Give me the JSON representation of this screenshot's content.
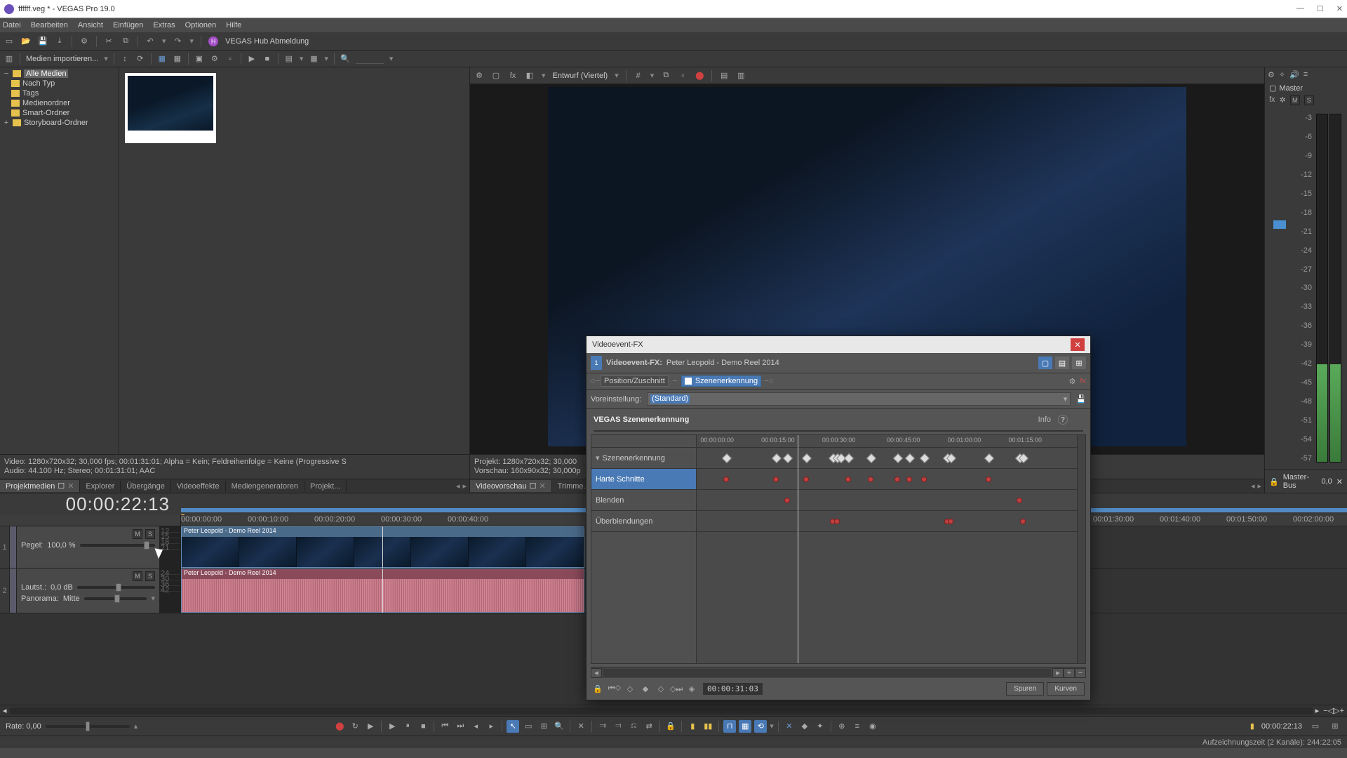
{
  "window": {
    "title": "ffffff.veg * - VEGAS Pro 19.0"
  },
  "menu": [
    "Datei",
    "Bearbeiten",
    "Ansicht",
    "Einfügen",
    "Extras",
    "Optionen",
    "Hilfe"
  ],
  "hub": {
    "label": "VEGAS Hub Abmeldung",
    "badge": "H"
  },
  "import_btn": "Medien importieren...",
  "media_tree": {
    "items": [
      {
        "label": "Alle Medien",
        "selected": true
      },
      {
        "label": "Nach Typ"
      },
      {
        "label": "Tags"
      },
      {
        "label": "Medienordner"
      },
      {
        "label": "Smart-Ordner"
      },
      {
        "label": "Storyboard-Ordner",
        "expandable": true
      }
    ]
  },
  "left_info": {
    "line1": "Video: 1280x720x32; 30,000 fps; 00:01:31:01; Alpha = Kein; Feldreihenfolge = Keine (Progressive S",
    "line2": "Audio: 44.100 Hz; Stereo; 00:01:31:01; AAC"
  },
  "dock_left": {
    "tabs": [
      "Projektmedien",
      "Explorer",
      "Übergänge",
      "Videoeffekte",
      "Mediengeneratoren",
      "Projekt..."
    ],
    "active": 0
  },
  "preview": {
    "quality": "Entwurf (Viertel)",
    "info1": "Projekt:    1280x720x32; 30,000",
    "info2": "Vorschau:  160x90x32; 30,000p",
    "tabs": [
      "Videovorschau",
      "Trimme..."
    ],
    "active": 0
  },
  "master": {
    "label": "Master",
    "ms": [
      "M",
      "S"
    ],
    "scale": [
      "-3",
      "-6",
      "-9",
      "-12",
      "-15",
      "-18",
      "-21",
      "-24",
      "-27",
      "-30",
      "-33",
      "-36",
      "-39",
      "-42",
      "-45",
      "-48",
      "-51",
      "-54",
      "-57"
    ],
    "bus": "Master-Bus",
    "bus_val": "0,0"
  },
  "timeline": {
    "timecode": "00:00:22:13",
    "ruler": [
      "00:00:00:00",
      "00:00:10:00",
      "00:00:20:00",
      "00:00:30:00",
      "00:00:40:00",
      "00:01:30:00",
      "00:01:40:00",
      "00:01:50:00",
      "00:02:00:00"
    ],
    "track1": {
      "num": "1",
      "pegel_label": "Pegel:",
      "pegel_value": "100,0 %",
      "ms": [
        "M",
        "S"
      ],
      "clip_label": "Peter Leopold - Demo Reel 2014",
      "meter": [
        "12",
        "15",
        "18",
        "21"
      ]
    },
    "track2": {
      "num": "2",
      "laut_label": "Lautst.:",
      "laut_value": "0,0 dB",
      "pan_label": "Panorama:",
      "pan_value": "Mitte",
      "ms": [
        "M",
        "S"
      ],
      "clip_label": "Peter Leopold - Demo Reel 2014",
      "meter": [
        "24",
        "30",
        "36",
        "42"
      ]
    }
  },
  "transport": {
    "rate_label": "Rate: 0,00",
    "timecode": "00:00:22:13"
  },
  "status": {
    "right": "Aufzeichnungszeit (2 Kanäle): 244:22:05"
  },
  "fx": {
    "title": "Videoevent-FX",
    "chain_label": "Videoevent-FX:",
    "clip_name": "Peter Leopold - Demo Reel 2014",
    "nodes": [
      {
        "label": "Position/Zuschnitt",
        "active": false
      },
      {
        "label": "Szenenerkennung",
        "active": true
      }
    ],
    "preset_label": "Voreinstellung:",
    "preset_value": "(Standard)",
    "heading": "VEGAS Szenenerkennung",
    "info": "Info",
    "ruler": [
      "00:00:00:00",
      "00:00:15:00",
      "00:00:30:00",
      "00:00:45:00",
      "00:01:00:00",
      "00:01:15:00"
    ],
    "rows": [
      {
        "label": "Szenenerkennung",
        "collapsible": true
      },
      {
        "label": "Harte Schnitte",
        "selected": true
      },
      {
        "label": "Blenden"
      },
      {
        "label": "Überblendungen"
      }
    ],
    "keyframes": {
      "scene": [
        8,
        21,
        24,
        29,
        36,
        37,
        38,
        40,
        46,
        53,
        56,
        60,
        66,
        67,
        77,
        85,
        86
      ],
      "hard": [
        8,
        21,
        29,
        40,
        46,
        53,
        56,
        60,
        77
      ],
      "blend": [
        24,
        85
      ],
      "cross": [
        36,
        37,
        66,
        67,
        86
      ]
    },
    "cursor_pct": 26,
    "bottom_tc": "00:00:31:03",
    "mode_btns": [
      "Spuren",
      "Kurven"
    ]
  }
}
